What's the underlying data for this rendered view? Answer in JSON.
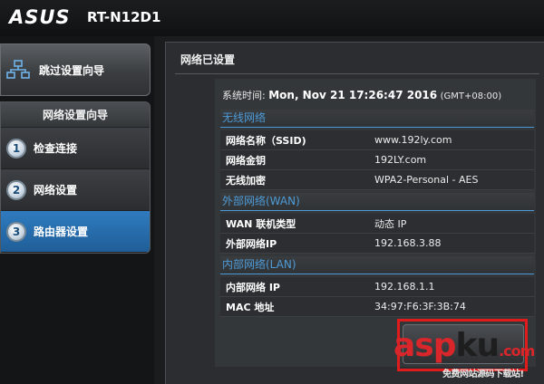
{
  "header": {
    "brand": "ASUS",
    "model": "RT-N12D1"
  },
  "sidebar": {
    "wizard_button": "跳过设置向导",
    "nav_title": "网络设置向导",
    "items": [
      {
        "number": "1",
        "label": "检查连接"
      },
      {
        "number": "2",
        "label": "网络设置"
      },
      {
        "number": "3",
        "label": "路由器设置"
      }
    ]
  },
  "main": {
    "title": "网络已设置",
    "system_time_label": "系统时间:",
    "system_time_value": "Mon, Nov 21 17:26:47 2016",
    "system_time_tz": "(GMT+08:00)",
    "wireless": {
      "heading": "无线网络",
      "ssid_label": "网络名称（SSID)",
      "ssid_value": "www.192ly.com",
      "key_label": "网络金钥",
      "key_value": "192LY.com",
      "enc_label": "无线加密",
      "enc_value": "WPA2-Personal - AES"
    },
    "wan": {
      "heading": "外部网络(WAN)",
      "type_label": "WAN 联机类型",
      "type_value": "动态 IP",
      "ip_label": "外部网络IP",
      "ip_value": "192.168.3.88"
    },
    "lan": {
      "heading": "内部网络(LAN)",
      "ip_label": "内部网络 IP",
      "ip_value": "192.168.1.1",
      "mac_label": "MAC 地址",
      "mac_value": "34:97:F6:3F:3B:74"
    }
  },
  "watermark": {
    "brand_a": "asp",
    "brand_b": "ku",
    "brand_tld": ".com",
    "tagline": "免费网站源码下载站!"
  },
  "colors": {
    "accent_blue": "#4d9ad6",
    "active_nav": "#2f7bbf",
    "highlight_red": "#e01b1b"
  }
}
